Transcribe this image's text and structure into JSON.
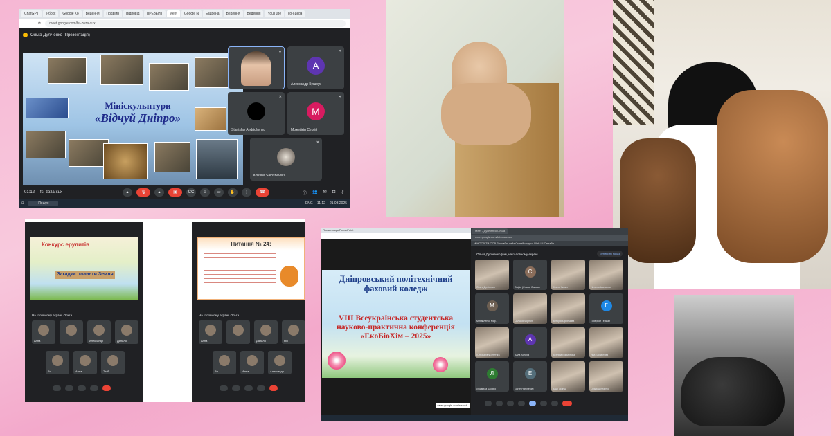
{
  "meet1": {
    "tabs": [
      "ChatGPT",
      "Інбокс",
      "Google Ко",
      "Ведення",
      "Подвійн",
      "Відповід",
      "ПРЕЗЕНТ",
      "Meet",
      "Google N",
      "Ездрена",
      "Ведення",
      "Ведення",
      "YouTube",
      "кон-дерз"
    ],
    "url": "meet.google.com/fsi-zoza-xux",
    "presenter": "Ольга Дуліченко (Презентація)",
    "slide_line1": "Мініскульптури",
    "slide_line2": "«Відчуй Дніпро»",
    "participants": [
      {
        "name": "",
        "letter": ""
      },
      {
        "name": "Александр Бушрук",
        "letter": "A",
        "color": "#5e35b1"
      },
      {
        "name": "Stanislav Andrichenko",
        "letter": "",
        "color": "#000000"
      },
      {
        "name": "Можейкін Сергій",
        "letter": "M",
        "color": "#d81b60"
      },
      {
        "name": "Kristina Saloshevska",
        "letter": ""
      }
    ],
    "time": "01:12",
    "meeting_code": "fsi-zoza-xux",
    "taskbar_search": "Пошук",
    "clock": "11:12",
    "date": "21.03.2025",
    "lang": "ENG"
  },
  "phones": {
    "left": {
      "slide_title": "Конкурс ерудитів",
      "slide_sub": "Загадки планети Земля",
      "on_screen": "На головному екрані: Ольга",
      "names": [
        "Анна",
        "",
        "Александр",
        "Данило",
        "Ви",
        "Анна",
        "Тімб"
      ]
    },
    "right": {
      "slide_title": "Питання № 24:",
      "on_screen": "На головному екрані: Ольга",
      "names": [
        "Анна",
        "",
        "Данило",
        "Ніб",
        "Ви",
        "Анна",
        "Александр"
      ]
    }
  },
  "conf": {
    "window_title": "Презентація PowerPoint",
    "college": "Дніпровський політехнічний фаховий коледж",
    "conference": "VIII Всеукраїнська студентська науково-практична конференція «ЕкоБіоХім – 2025»",
    "link": "www.google.com/search"
  },
  "gallery": {
    "tabs": [
      "Meet - Дуліченко Ольга"
    ],
    "url": "meet.google.com/fsi-zoza-xux",
    "bookmarks": "МІНОСВІТИ ОСВ   Звичайні сайт   Онлайн-курси   Web UI   Онлайн",
    "banner": "Ольга Дуліченко (ви), на головному екрані",
    "stop_label": "Зупинити показ",
    "tiles": [
      {
        "name": "Ольга Дуліченко",
        "letter": "",
        "cam": true
      },
      {
        "name": "Софія (Стася) Самоян",
        "letter": "C",
        "color": "#8a6d5a",
        "cam": false
      },
      {
        "name": "Кірило Хирич",
        "letter": "",
        "cam": true
      },
      {
        "name": "Наталія Іванченко",
        "letter": "",
        "cam": true
      },
      {
        "name": "Михайленко Мар.",
        "letter": "M",
        "color": "#6d5f52",
        "cam": false
      },
      {
        "name": "Сильвія Чорнол",
        "letter": "",
        "cam": true
      },
      {
        "name": "Вікторія Єфремова",
        "letter": "",
        "cam": true
      },
      {
        "name": "Гоберсон Герман",
        "letter": "Г",
        "color": "#1e88e5",
        "cam": false
      },
      {
        "name": "(Стефанівна) Нетяга",
        "letter": "",
        "cam": true
      },
      {
        "name": "Алла Коноба",
        "letter": "A",
        "color": "#5e35b1",
        "cam": false
      },
      {
        "name": "Віталіна Бормотова",
        "letter": "",
        "cam": true
      },
      {
        "name": "Яна Бормотова",
        "letter": "",
        "cam": true
      },
      {
        "name": "Людмила Шкурко",
        "letter": "Л",
        "color": "#2e7d32",
        "cam": false
      },
      {
        "name": "Євген Нагулевич",
        "letter": "Е",
        "color": "#546e7a",
        "cam": false
      },
      {
        "name": "Ваші 18 інш.",
        "letter": "",
        "cam": true
      },
      {
        "name": "Ольга Дуліченко",
        "letter": "",
        "cam": true
      }
    ],
    "clock": "11:10",
    "date": "21.03.2025"
  }
}
